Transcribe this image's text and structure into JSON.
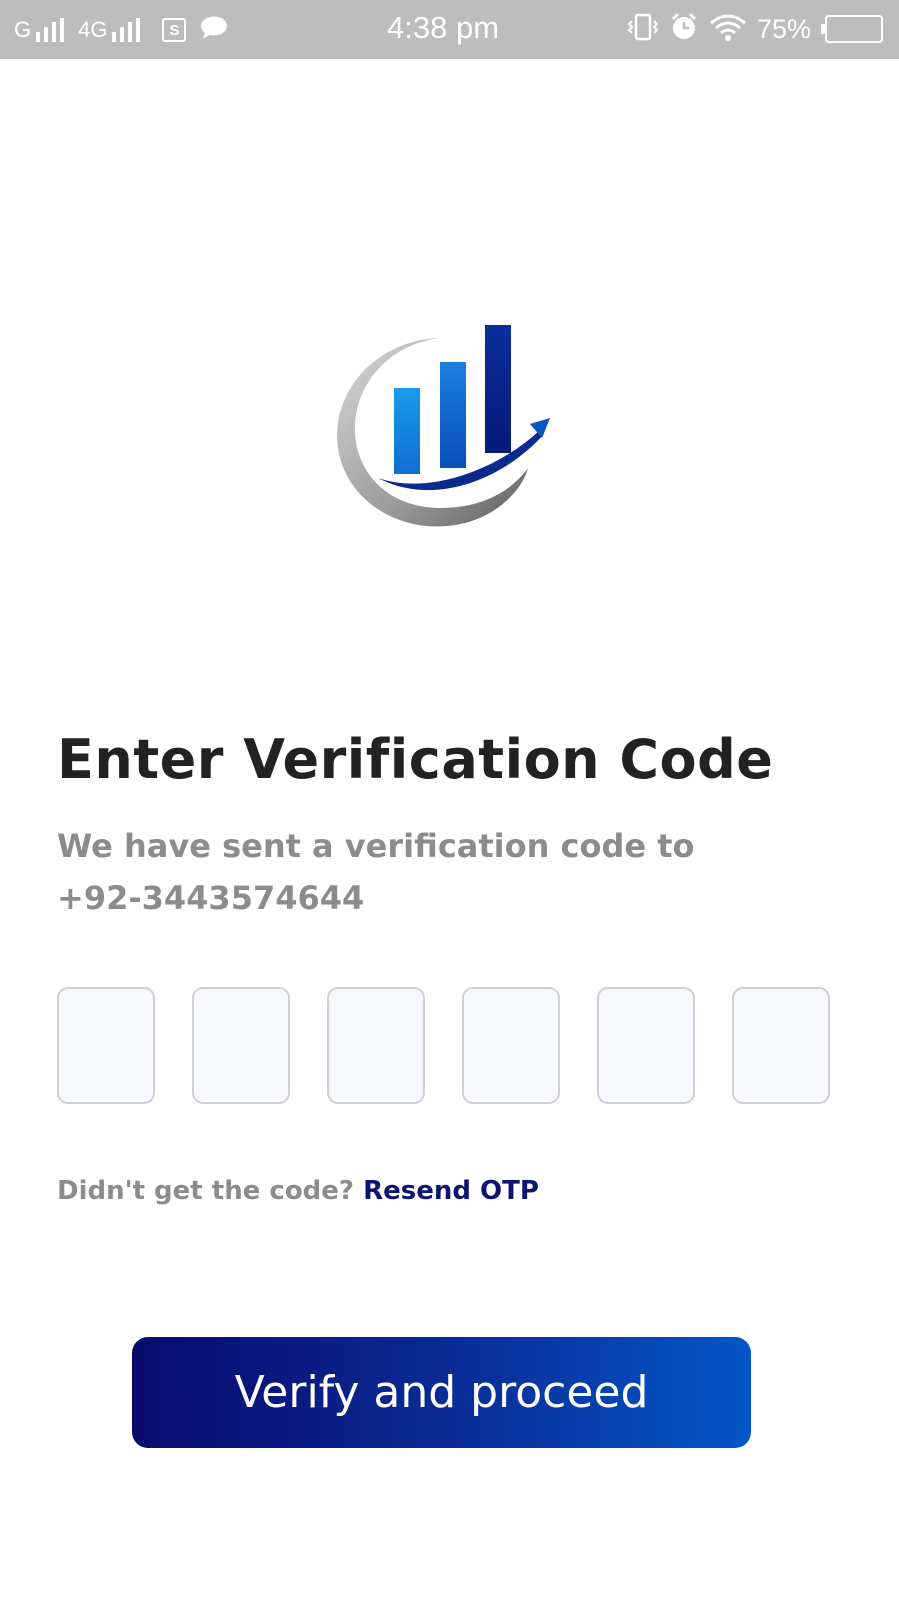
{
  "status_bar": {
    "network_1": "G",
    "network_2": "4G",
    "sim_label": "S",
    "time": "4:38 pm",
    "battery_percent": "75%",
    "battery_level": 0,
    "icons": [
      "signal-icon",
      "sim-card-icon",
      "chat-bubble-icon",
      "vibrate-icon",
      "alarm-icon",
      "wifi-icon",
      "battery-icon"
    ]
  },
  "logo": {
    "icon": "bar-chart-growth-logo",
    "colors": [
      "#1c8fe0",
      "#0a55c0",
      "#0b1a7a",
      "#9e9e9e"
    ]
  },
  "header": {
    "title": "Enter Verification Code",
    "subtitle_line1": "We have sent a verification code to",
    "phone_number": "+92-3443574644"
  },
  "otp": {
    "digits": [
      "",
      "",
      "",
      "",
      "",
      ""
    ]
  },
  "resend": {
    "prompt": "Didn't get the code?",
    "link_label": "Resend OTP",
    "link_color": "#0d1570"
  },
  "actions": {
    "verify_label": "Verify and proceed",
    "gradient": [
      "#0a0a6e",
      "#0356c8"
    ]
  }
}
